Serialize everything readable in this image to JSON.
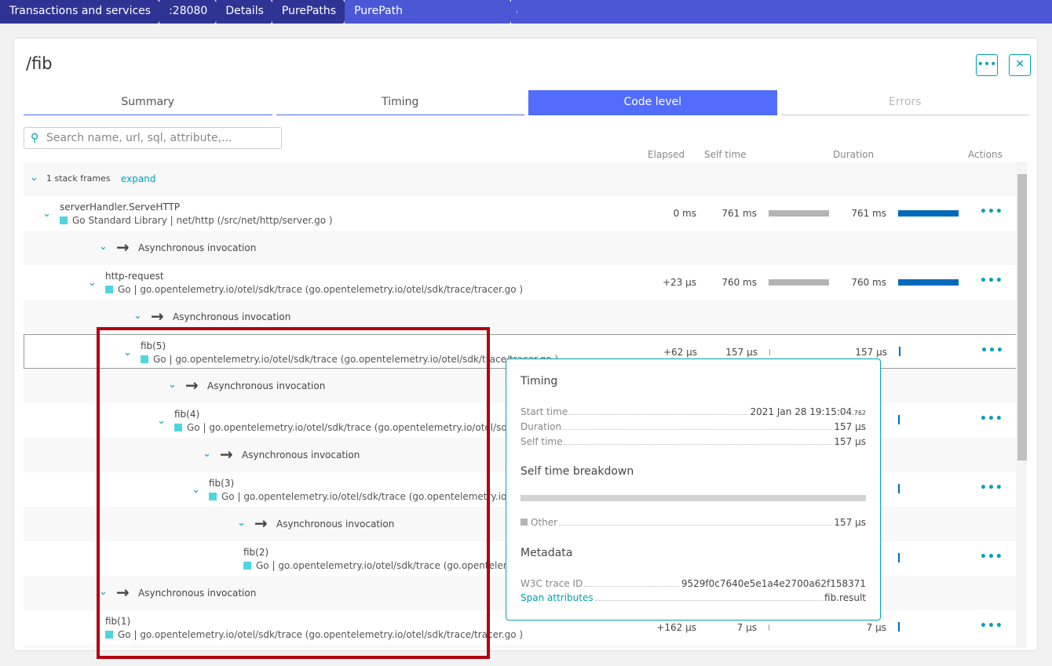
{
  "breadcrumb": [
    "Transactions and services",
    ":28080",
    "Details",
    "PurePaths",
    "PurePath"
  ],
  "page": {
    "title": "/fib",
    "more_icon": "more-horizontal-icon",
    "close_icon": "close-icon"
  },
  "tabs": [
    "Summary",
    "Timing",
    "Code level",
    "Errors"
  ],
  "active_tab": "Code level",
  "search": {
    "placeholder": "Search name, url, sql, attribute,..."
  },
  "columns": {
    "elapsed": "Elapsed",
    "self_time": "Self time",
    "duration": "Duration",
    "actions": "Actions"
  },
  "stack": {
    "label": "1 stack frames",
    "expand": "expand"
  },
  "rows": [
    {
      "type": "node",
      "level": 0,
      "name": "serverHandler.ServeHTTP",
      "sub": "Go Standard Library | net/http (/src/net/http/server.go )",
      "elapsed": "0 ms",
      "self": "761 ms",
      "duration": "761 ms",
      "self_frac": 1.0,
      "dur_frac": 1.0
    },
    {
      "type": "async",
      "level": 1,
      "label": "Asynchronous invocation"
    },
    {
      "type": "node",
      "level": 1,
      "name": "http-request",
      "sub": "Go | go.opentelemetry.io/otel/sdk/trace (go.opentelemetry.io/otel/sdk/trace/tracer.go )",
      "elapsed": "+23 µs",
      "self": "760 ms",
      "duration": "760 ms",
      "self_frac": 1.0,
      "dur_frac": 1.0
    },
    {
      "type": "async",
      "level": 2,
      "label": "Asynchronous invocation"
    },
    {
      "type": "node",
      "level": 2,
      "name": "fib(5)",
      "sub": "Go | go.opentelemetry.io/otel/sdk/trace (go.opentelemetry.io/otel/sdk/trace/tracer.go )",
      "elapsed": "+62 µs",
      "self": "157 µs",
      "duration": "157 µs",
      "self_frac": 0.0,
      "dur_frac": 0.0,
      "selected": true
    },
    {
      "type": "async",
      "level": 3,
      "label": "Asynchronous invocation"
    },
    {
      "type": "node",
      "level": 3,
      "name": "fib(4)",
      "sub": "Go | go.opentelemetry.io/otel/sdk/trace (go.opentelemetry.io/otel/sdk/trace/tracer.go )",
      "dur_frac": 0.0
    },
    {
      "type": "async",
      "level": 4,
      "label": "Asynchronous invocation"
    },
    {
      "type": "node",
      "level": 4,
      "name": "fib(3)",
      "sub": "Go | go.opentelemetry.io/otel/sdk/trace (go.opentelemetry.io/otel/sdk/trace/tracer.go )",
      "dur_frac": 0.0
    },
    {
      "type": "async",
      "level": 5,
      "label": "Asynchronous invocation"
    },
    {
      "type": "node",
      "level": 5,
      "leaf": true,
      "name": "fib(2)",
      "sub": "Go | go.opentelemetry.io/otel/sdk/trace (go.opentelemetry.io/otel/sdk/trace/tracer.go )",
      "dur_frac": 0.0
    },
    {
      "type": "async",
      "level": 1,
      "label": "Asynchronous invocation"
    },
    {
      "type": "node",
      "level": 1,
      "leaf": true,
      "name": "fib(1)",
      "sub": "Go | go.opentelemetry.io/otel/sdk/trace (go.opentelemetry.io/otel/sdk/trace/tracer.go )",
      "elapsed": "+162 µs",
      "self": "7 µs",
      "duration": "7 µs",
      "self_frac": 0.0,
      "dur_frac": 0.0
    }
  ],
  "popup": {
    "timing_title": "Timing",
    "start_label": "Start time",
    "start_value": "2021 Jan 28 19:15:04",
    "start_ms": ".762",
    "duration_label": "Duration",
    "duration_value": "157 µs",
    "self_label": "Self time",
    "self_value": "157 µs",
    "breakdown_title": "Self time breakdown",
    "other_label": "Other",
    "other_value": "157 µs",
    "other_frac": 1.0,
    "metadata_title": "Metadata",
    "trace_label": "W3C trace ID",
    "trace_value": "9529f0c7640e5e1a4e2700a62f158371",
    "span_label": "Span attributes",
    "span_value": "fib.result"
  },
  "colors": {
    "accent": "#00a1b2",
    "tab_active": "#526cfe",
    "duration_bar": "#006bba",
    "self_bar": "#b4b4b4",
    "highlight": "#b3000f"
  }
}
